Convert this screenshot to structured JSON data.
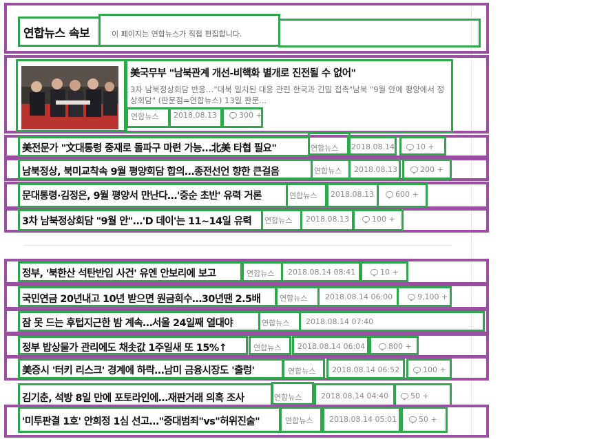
{
  "header": {
    "title": "연합뉴스 속보",
    "description": "이 페이지는 연합뉴스가 직접 편집합니다."
  },
  "featured": {
    "headline": "美국무부 \"남북관계 개선-비핵화 별개로 진전될 수 없어\"",
    "summary": "3차 남북정상회담 반응…\"대북 일치된 대응 관련 한국과 긴밀 접촉\"남북 \"9월 안에 평양에서 정상회담\" (판문점=연합뉴스) 13일 판문...",
    "source": "연합뉴스",
    "date": "2018.08.13",
    "comments": "300 +"
  },
  "top_list": [
    {
      "headline": "美전문가 \"文대통령 중재로 돌파구 마련 가능…北美 타협 필요\"",
      "source": "연합뉴스",
      "date": "2018.08.14",
      "comments": "10 +"
    },
    {
      "headline": "남북정상, 북미교착속 9월 평양회담 합의…종전선언 향한 큰걸음",
      "source": "연합뉴스",
      "date": "2018.08.13",
      "comments": "200 +"
    },
    {
      "headline": "문대통령·김정은, 9월 평양서 만난다…'중순 초반' 유력 거론",
      "source": "연합뉴스",
      "date": "2018.08.13",
      "comments": "600 +"
    },
    {
      "headline": "3차 남북정상회담 \"9월 안\"…'D 데이'는 11~14일 유력",
      "source": "연합뉴스",
      "date": "2018.08.13",
      "comments": "100 +"
    }
  ],
  "latest_list": [
    {
      "headline": "정부, '북한산 석탄반입 사건' 유엔 안보리에 보고",
      "source": "연합뉴스",
      "date": "2018.08.14 08:41",
      "comments": "10 +"
    },
    {
      "headline": "국민연금 20년내고 10년 받으면 원금회수…30년땐 2.5배",
      "source": "연합뉴스",
      "date": "2018.08.14 06:00",
      "comments": "9,100 +"
    },
    {
      "headline": "잠 못 드는 후텁지근한 밤 계속…서울 24일째 열대야",
      "source": "연합뉴스",
      "date": "2018.08.14 07:40",
      "comments": ""
    },
    {
      "headline": "정부 밥상물가 관리에도 채솟값 1주일새 또 15%↑",
      "source": "연합뉴스",
      "date": "2018.08.14 06:04",
      "comments": "800 +"
    },
    {
      "headline": "美증시 '터키 리스크' 경계에 하락…남미 금융시장도 '출렁'",
      "source": "연합뉴스",
      "date": "2018.08.14 06:52",
      "comments": "100 +"
    },
    {
      "headline": "김기춘, 석방 8일 만에 포토라인에…재판거래 의혹 조사",
      "source": "연합뉴스",
      "date": "2018.08.14 04:40",
      "comments": "50 +"
    },
    {
      "headline": "'미투판결 1호' 안희정 1심 선고…\"중대범죄\"vs\"허위진술\"",
      "source": "연합뉴스",
      "date": "2018.08.14 05:01",
      "comments": "50 +"
    }
  ],
  "colors": {
    "frame_purple": "#9b4fa3",
    "frame_green": "#2ea84a",
    "meta_gray": "#8a8a8a"
  },
  "icons": {
    "comment": "comment-bubble-icon"
  }
}
